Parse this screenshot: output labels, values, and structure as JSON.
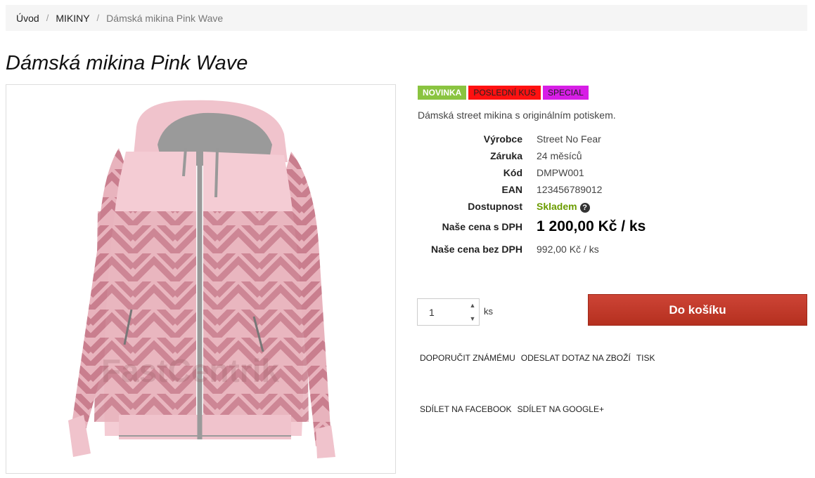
{
  "breadcrumb": {
    "home": "Úvod",
    "category": "MIKINY",
    "current": "Dámská mikina Pink Wave",
    "separator": "/"
  },
  "product": {
    "title": "Dámská mikina Pink Wave",
    "watermark": "FastCentrik",
    "flags": {
      "new": "NOVINKA",
      "last": "POSLEDNÍ KUS",
      "special": "SPECIAL"
    },
    "short_description": "Dámská street mikina s originálním potiskem.",
    "params": {
      "manufacturer_label": "Výrobce",
      "manufacturer": "Street No Fear",
      "warranty_label": "Záruka",
      "warranty": "24 měsíců",
      "code_label": "Kód",
      "code": "DMPW001",
      "ean_label": "EAN",
      "ean": "123456789012",
      "availability_label": "Dostupnost",
      "availability": "Skladem",
      "price_vat_label": "Naše cena s DPH",
      "price_vat": "1 200,00 Kč / ks",
      "price_novat_label": "Naše cena bez DPH",
      "price_novat": "992,00 Kč / ks"
    },
    "quantity": "1",
    "quantity_unit": "ks",
    "add_to_cart": "Do košíku"
  },
  "actions": {
    "recommend": "DOPORUČIT ZNÁMÉMU",
    "ask": "ODESLAT DOTAZ NA ZBOŽÍ",
    "print": "TISK",
    "share_facebook": "SDÍLET NA FACEBOOK",
    "share_google": "SDÍLET NA GOOGLE+"
  },
  "icons": {
    "help": "question-circle-icon",
    "spin_up": "arrow-up-icon",
    "spin_down": "arrow-down-icon"
  },
  "colors": {
    "flag_new": "#8ac440",
    "flag_last": "#ff1111",
    "flag_special": "#d71ee6",
    "cart_button": "#c0392b",
    "availability": "#6b9c00"
  }
}
